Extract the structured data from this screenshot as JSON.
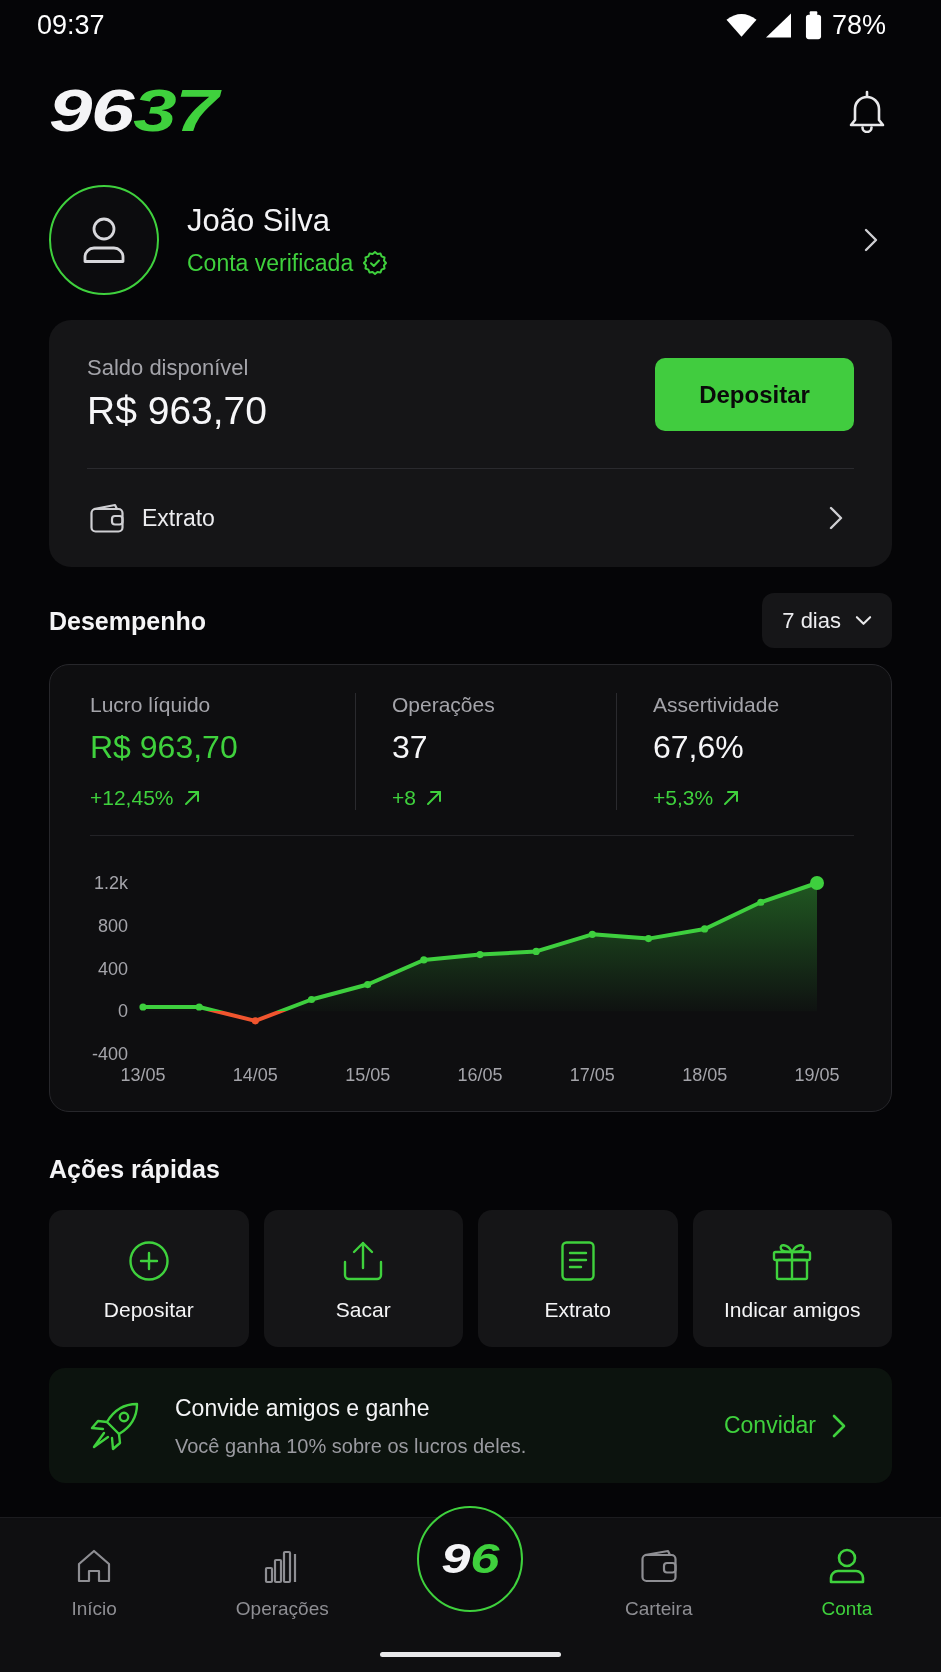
{
  "status_bar": {
    "time": "09:37",
    "battery": "78%"
  },
  "header": {
    "logo": [
      {
        "text": "96",
        "accent": false
      },
      {
        "text": "37",
        "accent": true
      }
    ]
  },
  "profile": {
    "name": "João Silva",
    "status": "Conta verificada",
    "verified": true
  },
  "balance": {
    "label": "Saldo disponível",
    "amount": "R$ 963,70",
    "button": "Depositar",
    "link": "Extrato"
  },
  "performance": {
    "title": "Desempenho",
    "period": "7 dias",
    "stats": [
      {
        "label": "Lucro líquido",
        "value": "R$ 963,70",
        "accent": true,
        "change": "+12,45%",
        "positive": true
      },
      {
        "label": "Operações",
        "value": "37",
        "accent": false,
        "change": "+8",
        "positive": true
      },
      {
        "label": "Assertividade",
        "value": "67,6%",
        "accent": false,
        "change": "+5,3%",
        "positive": true
      }
    ],
    "chart_data": {
      "type": "area",
      "categories": [
        "13/05",
        null,
        "14/05",
        null,
        "15/05",
        null,
        "16/05",
        null,
        "17/05",
        null,
        "18/05",
        null,
        "19/05"
      ],
      "values": [
        40,
        40,
        -90,
        110,
        250,
        480,
        530,
        560,
        720,
        680,
        770,
        1020,
        1200
      ],
      "ylim": [
        -400,
        1200
      ],
      "yticks": [
        -400,
        0,
        400,
        800,
        {
          "value": 1200,
          "label": "1.2k"
        }
      ]
    }
  },
  "quick_actions": {
    "title": "Ações rápidas",
    "items": [
      {
        "label": "Depositar"
      },
      {
        "label": "Sacar"
      },
      {
        "label": "Extrato"
      },
      {
        "label": "Indicar amigos"
      }
    ]
  },
  "invite": {
    "title": "Convide amigos e ganhe",
    "text": "Você ganha 10% sobre os lucros deles.",
    "action": "Convidar"
  },
  "bottom_nav": {
    "items": [
      {
        "kind": "tab",
        "label": "Início",
        "selected": false
      },
      {
        "kind": "tab",
        "label": "Operações",
        "selected": false
      },
      {
        "kind": "logo",
        "parts": [
          {
            "text": "9",
            "accent": false
          },
          {
            "text": "6",
            "accent": true
          }
        ]
      },
      {
        "kind": "tab",
        "label": "Carteira",
        "selected": false
      },
      {
        "kind": "tab",
        "label": "Conta",
        "selected": true
      }
    ]
  }
}
